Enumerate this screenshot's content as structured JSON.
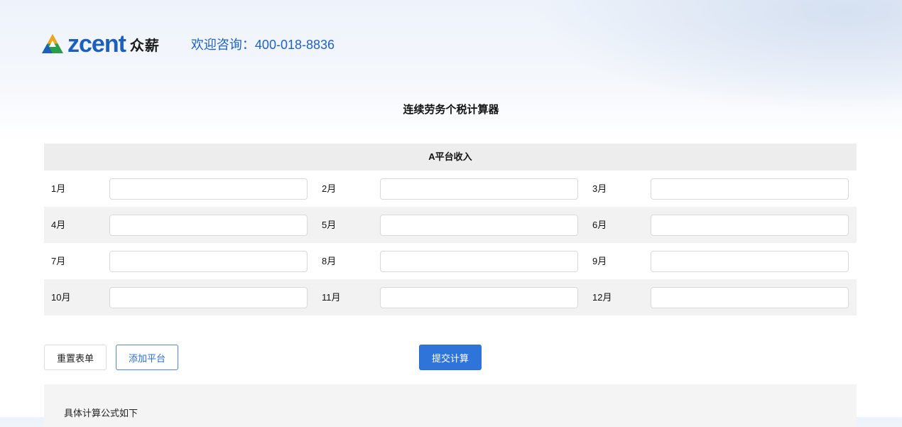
{
  "header": {
    "logo_text": "zcent",
    "logo_cn": "众薪",
    "hotline": "欢迎咨询：400-018-8836"
  },
  "page_title": "连续劳务个税计算器",
  "panel": {
    "title": "A平台收入",
    "months": [
      {
        "label": "1月",
        "value": ""
      },
      {
        "label": "2月",
        "value": ""
      },
      {
        "label": "3月",
        "value": ""
      },
      {
        "label": "4月",
        "value": ""
      },
      {
        "label": "5月",
        "value": ""
      },
      {
        "label": "6月",
        "value": ""
      },
      {
        "label": "7月",
        "value": ""
      },
      {
        "label": "8月",
        "value": ""
      },
      {
        "label": "9月",
        "value": ""
      },
      {
        "label": "10月",
        "value": ""
      },
      {
        "label": "11月",
        "value": ""
      },
      {
        "label": "12月",
        "value": ""
      }
    ]
  },
  "actions": {
    "reset_label": "重置表单",
    "add_label": "添加平台",
    "submit_label": "提交计算"
  },
  "result": {
    "title": "具体计算公式如下"
  },
  "colors": {
    "brand_blue": "#1d5fbd",
    "primary_button": "#2f74d8"
  }
}
